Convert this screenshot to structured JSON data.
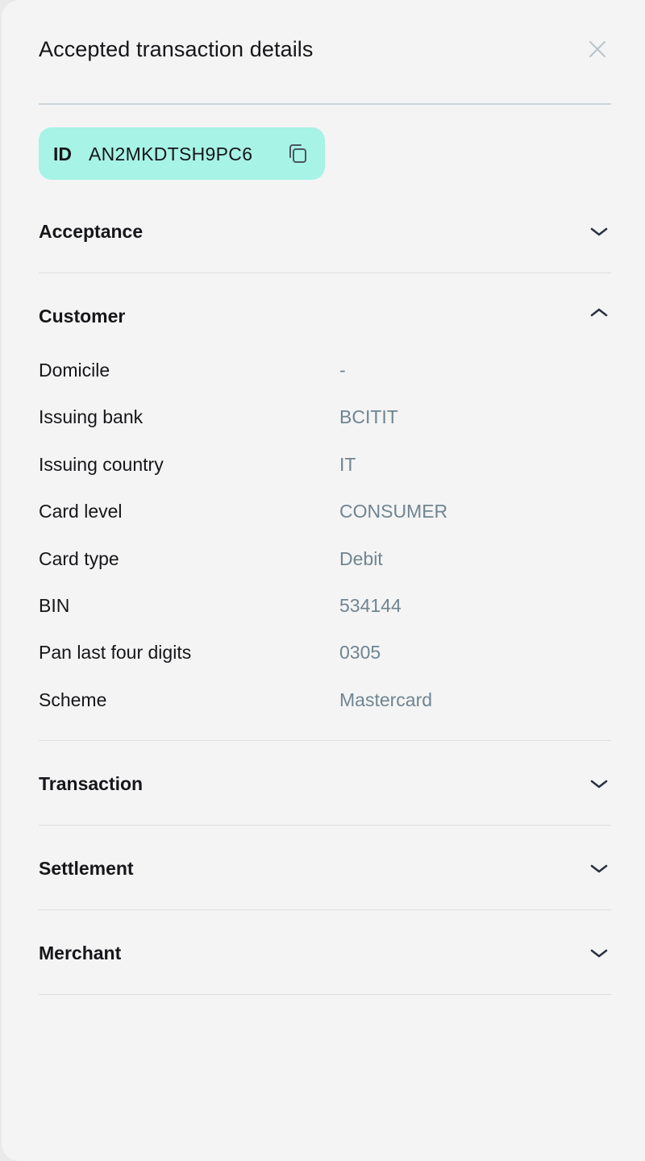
{
  "header": {
    "title": "Accepted transaction details",
    "close_icon": "close-icon"
  },
  "id_chip": {
    "label": "ID",
    "value": "AN2MKDTSH9PC6",
    "copy_icon": "copy-icon",
    "background": "#a7f3e6"
  },
  "sections": {
    "acceptance": {
      "title": "Acceptance",
      "expanded": false
    },
    "customer": {
      "title": "Customer",
      "expanded": true,
      "rows": [
        {
          "label": "Domicile",
          "value": "-"
        },
        {
          "label": "Issuing bank",
          "value": "BCITIT"
        },
        {
          "label": "Issuing country",
          "value": "IT"
        },
        {
          "label": "Card level",
          "value": "CONSUMER"
        },
        {
          "label": "Card type",
          "value": "Debit"
        },
        {
          "label": "BIN",
          "value": "534144"
        },
        {
          "label": "Pan last four digits",
          "value": "0305"
        },
        {
          "label": "Scheme",
          "value": "Mastercard"
        }
      ]
    },
    "transaction": {
      "title": "Transaction",
      "expanded": false
    },
    "settlement": {
      "title": "Settlement",
      "expanded": false
    },
    "merchant": {
      "title": "Merchant",
      "expanded": false
    }
  },
  "colors": {
    "panel_bg": "#f4f4f4",
    "text": "#16161a",
    "value_text": "#6f8592",
    "divider": "#dcdfe1",
    "chevron": "#2b3140"
  }
}
